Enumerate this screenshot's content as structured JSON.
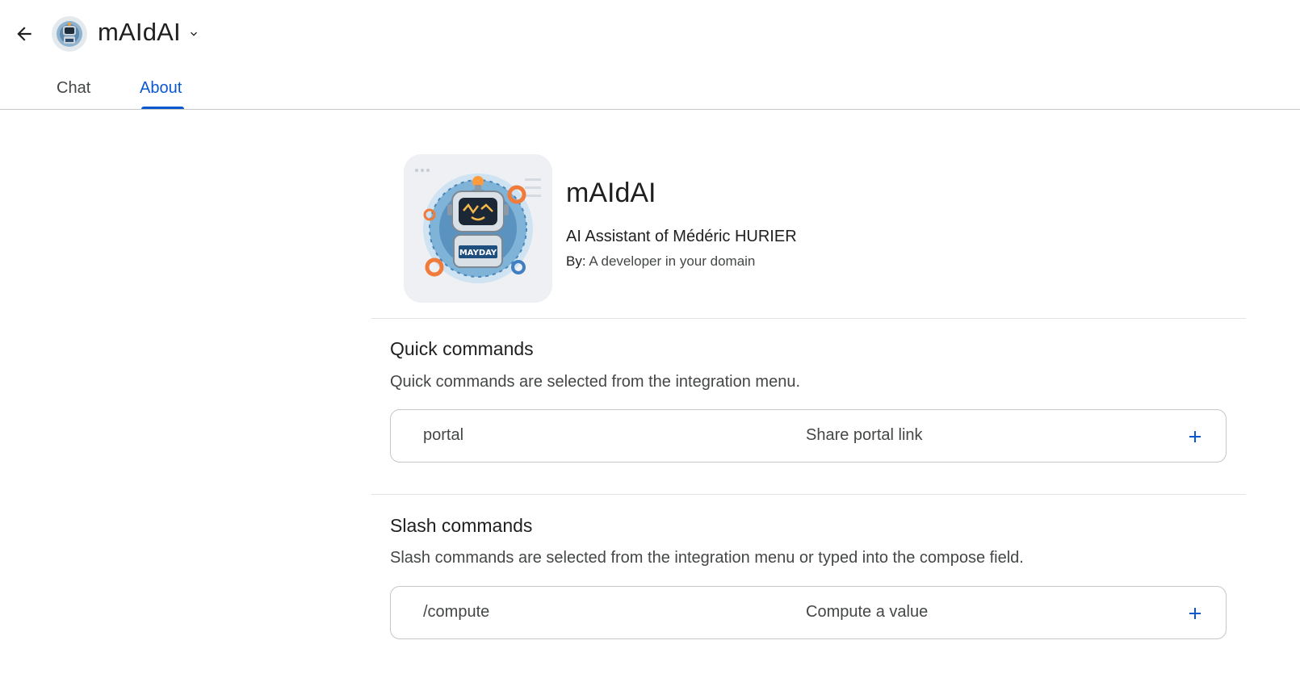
{
  "header": {
    "back_icon": "arrow-back-icon",
    "app_name": "mAIdAI",
    "dropdown_icon": "chevron-down-icon"
  },
  "tabs": [
    {
      "label": "Chat",
      "active": false
    },
    {
      "label": "About",
      "active": true
    }
  ],
  "bot": {
    "name": "mAIdAI",
    "description": "AI Assistant of Médéric HURIER",
    "by_label": "By:",
    "by_value": "A developer in your domain",
    "badge_text": "MAYDAY"
  },
  "quick_commands": {
    "title": "Quick commands",
    "description": "Quick commands are selected from the integration menu.",
    "items": [
      {
        "name": "portal",
        "description": "Share portal link",
        "action_icon": "plus-icon"
      }
    ]
  },
  "slash_commands": {
    "title": "Slash commands",
    "description": "Slash commands are selected from the integration menu or typed into the compose field.",
    "items": [
      {
        "name": "/compute",
        "description": "Compute a value",
        "action_icon": "plus-icon"
      }
    ]
  },
  "colors": {
    "accent": "#0b57d0",
    "text_primary": "#1f1f1f",
    "text_secondary": "#444746",
    "border": "#c4c7c5"
  }
}
